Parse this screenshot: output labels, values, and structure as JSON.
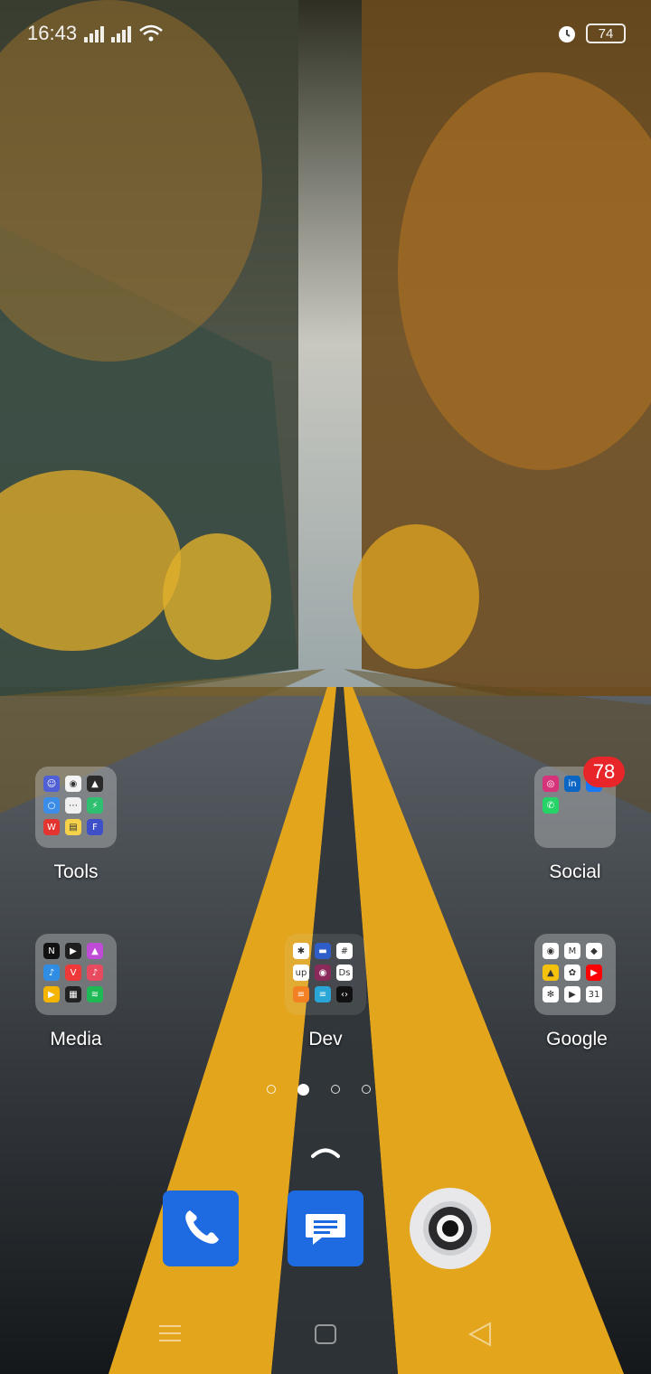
{
  "status_bar": {
    "time": "16:43",
    "battery": "74",
    "icons": [
      "signal-icon",
      "signal-icon",
      "wifi-icon",
      "alarm-icon",
      "battery-icon"
    ]
  },
  "folders": [
    {
      "label": "Tools",
      "apps": [
        {
          "icon": "contacts-icon",
          "glyph": "☺",
          "color": "#4f5fd6"
        },
        {
          "icon": "sound-icon",
          "glyph": "◉",
          "color": "#f4f4f4"
        },
        {
          "icon": "navigation-icon",
          "glyph": "▲",
          "color": "#2a2a2a"
        },
        {
          "icon": "browser-icon",
          "glyph": "○",
          "color": "#3b8de8"
        },
        {
          "icon": "keyboard-icon",
          "glyph": "⋯",
          "color": "#f0f0f0"
        },
        {
          "icon": "bolt-icon",
          "glyph": "⚡",
          "color": "#2fbf71"
        },
        {
          "icon": "wps-icon",
          "glyph": "W",
          "color": "#e3342f"
        },
        {
          "icon": "notes-icon",
          "glyph": "▤",
          "color": "#f6d24a"
        },
        {
          "icon": "forms-icon",
          "glyph": "F",
          "color": "#3f4fc8"
        }
      ]
    },
    {
      "label": "Social",
      "badge": "78",
      "apps": [
        {
          "icon": "instagram-icon",
          "glyph": "◎",
          "color": "#d6337a"
        },
        {
          "icon": "linkedin-icon",
          "glyph": "in",
          "color": "#0a66c2"
        },
        {
          "icon": "facebook-icon",
          "glyph": "f",
          "color": "#1877f2"
        },
        {
          "icon": "whatsapp-icon",
          "glyph": "✆",
          "color": "#25d366"
        }
      ]
    },
    {
      "label": "Media",
      "apps": [
        {
          "icon": "netflix-icon",
          "glyph": "N",
          "color": "#111111"
        },
        {
          "icon": "player-icon",
          "glyph": "▶",
          "color": "#1e1e1e"
        },
        {
          "icon": "gallery-icon",
          "glyph": "▲",
          "color": "#c04bd6"
        },
        {
          "icon": "music-icon",
          "glyph": "♪",
          "color": "#2f8de4"
        },
        {
          "icon": "vivaldi-icon",
          "glyph": "V",
          "color": "#ef3939"
        },
        {
          "icon": "tiktok-icon",
          "glyph": "♪",
          "color": "#e84a5f"
        },
        {
          "icon": "podcast-icon",
          "glyph": "▶",
          "color": "#f4b400"
        },
        {
          "icon": "radio-icon",
          "glyph": "▦",
          "color": "#222222"
        },
        {
          "icon": "spotify-icon",
          "glyph": "≋",
          "color": "#1db954"
        }
      ]
    },
    {
      "label": "Dev",
      "apps": [
        {
          "icon": "runner-icon",
          "glyph": "✱",
          "color": "#ffffff"
        },
        {
          "icon": "mobile-icon",
          "glyph": "▬",
          "color": "#2f5ec8"
        },
        {
          "icon": "slack-icon",
          "glyph": "#",
          "color": "#ffffff"
        },
        {
          "icon": "upwork-icon",
          "glyph": "up",
          "color": "#ffffff"
        },
        {
          "icon": "git-icon",
          "glyph": "◉",
          "color": "#8a2a5a"
        },
        {
          "icon": "ds-icon",
          "glyph": "Ds",
          "color": "#ffffff"
        },
        {
          "icon": "stackoverflow-icon",
          "glyph": "≡",
          "color": "#f48024"
        },
        {
          "icon": "layers-icon",
          "glyph": "≡",
          "color": "#2aa6d6"
        },
        {
          "icon": "code-icon",
          "glyph": "‹›",
          "color": "#111111"
        }
      ]
    },
    {
      "label": "Google",
      "apps": [
        {
          "icon": "chrome-icon",
          "glyph": "◉",
          "color": "#ffffff"
        },
        {
          "icon": "gmail-icon",
          "glyph": "M",
          "color": "#ffffff"
        },
        {
          "icon": "maps-icon",
          "glyph": "◆",
          "color": "#ffffff"
        },
        {
          "icon": "drive-icon",
          "glyph": "▲",
          "color": "#f4c20d"
        },
        {
          "icon": "photos-icon",
          "glyph": "✿",
          "color": "#ffffff"
        },
        {
          "icon": "youtube-icon",
          "glyph": "▶",
          "color": "#ff0000"
        },
        {
          "icon": "pinwheel-icon",
          "glyph": "✻",
          "color": "#ffffff"
        },
        {
          "icon": "play-store-icon",
          "glyph": "▶",
          "color": "#ffffff"
        },
        {
          "icon": "calendar-icon",
          "glyph": "31",
          "color": "#ffffff"
        }
      ]
    }
  ],
  "page_indicator": {
    "count": 4,
    "active": 1
  },
  "dock": [
    {
      "name": "phone",
      "icon": "phone-icon",
      "color": "#1e6ae0"
    },
    {
      "name": "messages",
      "icon": "messages-icon",
      "color": "#1e6ae0"
    },
    {
      "name": "camera",
      "icon": "camera-icon",
      "color": "#e8e8ea"
    }
  ],
  "nav_bar": [
    "menu-icon",
    "home-icon",
    "back-icon"
  ]
}
